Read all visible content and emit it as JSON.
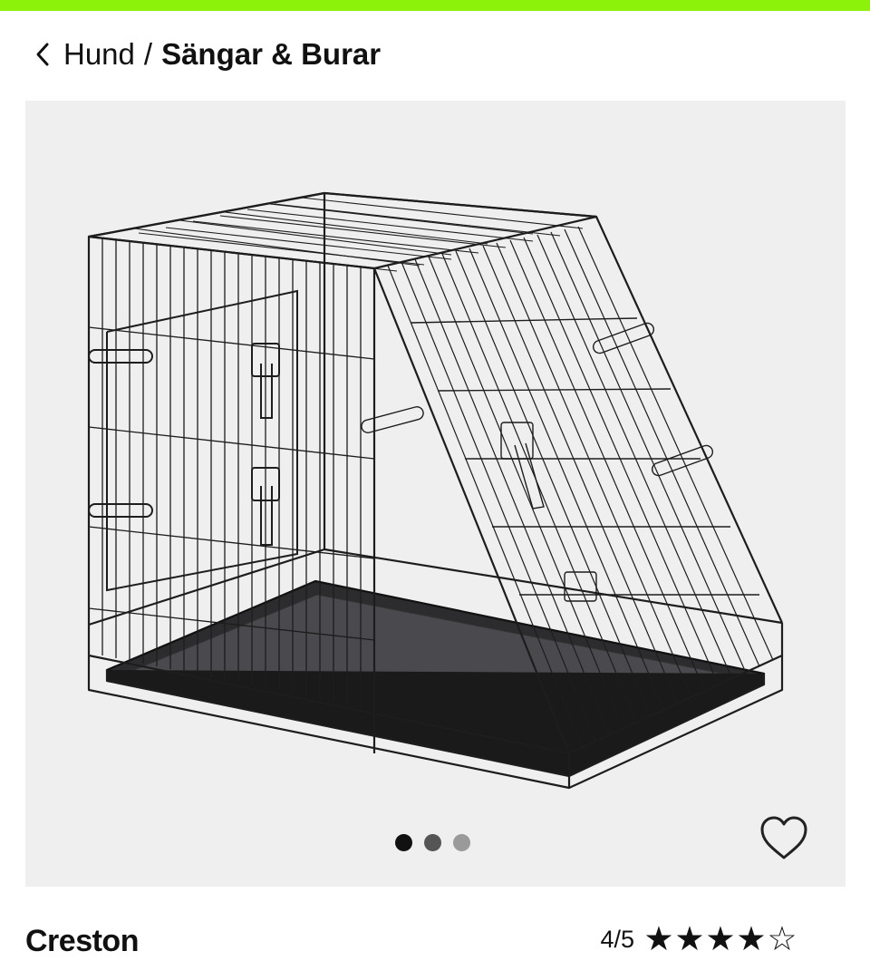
{
  "theme": {
    "accent": "#8cf20a",
    "image_background": "#efeff0",
    "dot_active": "#111111",
    "dot_mid": "#555555",
    "dot_inactive": "#9a9a9a"
  },
  "breadcrumb": {
    "back_icon": "chevron-left-icon",
    "parent": "Hund",
    "separator": "/",
    "current": "Sängar & Burar"
  },
  "gallery": {
    "image_subject": "foldable wire dog crate with sloped front and black plastic tray",
    "slide_count": 3,
    "active_slide": 1,
    "favorite_icon": "heart-outline-icon"
  },
  "product": {
    "brand": "Creston",
    "rating_text": "4/5",
    "rating_value": 4,
    "rating_max": 5,
    "star_full": "★",
    "star_empty": "☆"
  }
}
